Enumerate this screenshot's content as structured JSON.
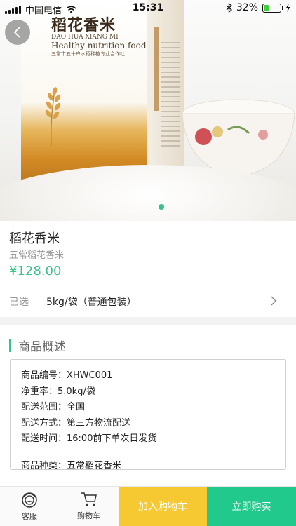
{
  "status_bar": {
    "carrier": "中国电信",
    "wifi_icon": "wifi-icon",
    "time": "15:31",
    "bluetooth_icon": "bluetooth-icon",
    "battery_percent": "32%",
    "battery_level": 0.32,
    "charging_icon": "charging-bolt-icon"
  },
  "hero": {
    "package_title": "稻花香米",
    "package_pinyin": "DAO HUA XIANG MI",
    "package_subtitle": "Healthy nutrition food",
    "package_producer": "五常市五十户水稻种植专业合作社",
    "slide_count": 1,
    "active_slide": 1
  },
  "product": {
    "title": "稻花香米",
    "subtitle": "五常稻花香米",
    "price": "¥128.00",
    "selected_label": "已选",
    "selected_value": "5kg/袋（普通包装）"
  },
  "overview": {
    "heading": "商品概述",
    "lines": [
      "商品编号：XHWC001",
      "净重率：5.0kg/袋",
      "配送范围：全国",
      "配送方式：第三方物流配送",
      "配送时间：16:00前下单次日发货",
      "商品种类：五常稻花香米"
    ]
  },
  "bottom_bar": {
    "service_label": "客服",
    "cart_label": "购物车",
    "add_to_cart": "加入购物车",
    "buy_now": "立即购买"
  },
  "colors": {
    "accent_green": "#37c28a",
    "buy_green": "#22c98c",
    "cart_yellow": "#f6c933"
  }
}
